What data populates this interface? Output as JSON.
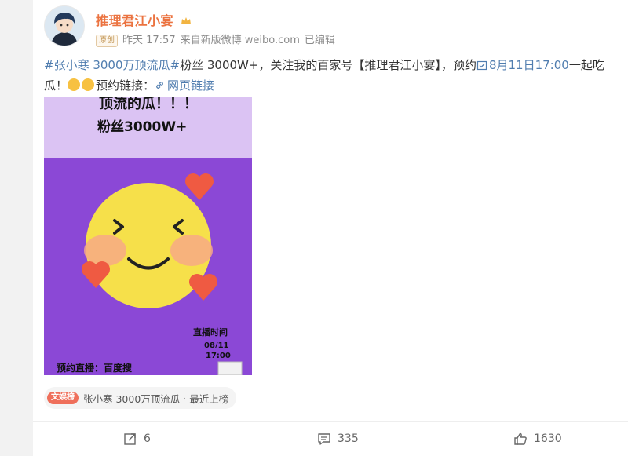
{
  "post": {
    "user_name": "推理君江小宴",
    "badge": "原创",
    "time": "昨天 17:57",
    "source": "来自新版微博 weibo.com",
    "edited": "已编辑",
    "text": {
      "hashtag": "#张小寒 3000万顶流瓜#",
      "part1": "粉丝 3000W+，关注我的百家号【推理君江小宴】，预约",
      "event": "8月11日17:00",
      "part2": "一起吃瓜！",
      "part3": "预约链接：",
      "web_link": "网页链接"
    },
    "image": {
      "line1": "顶流的瓜！！！",
      "line2": "粉丝3000W+",
      "time_label": "直播时间",
      "date": "08/11",
      "time": "17:00",
      "footer": "预约直播：百度搜"
    },
    "topic": {
      "badge": "文娱榜",
      "title": "张小寒 3000万顶流瓜",
      "sep": "·",
      "status": "最近上榜"
    },
    "actions": {
      "repost": "6",
      "comment": "335",
      "like": "1630"
    }
  }
}
